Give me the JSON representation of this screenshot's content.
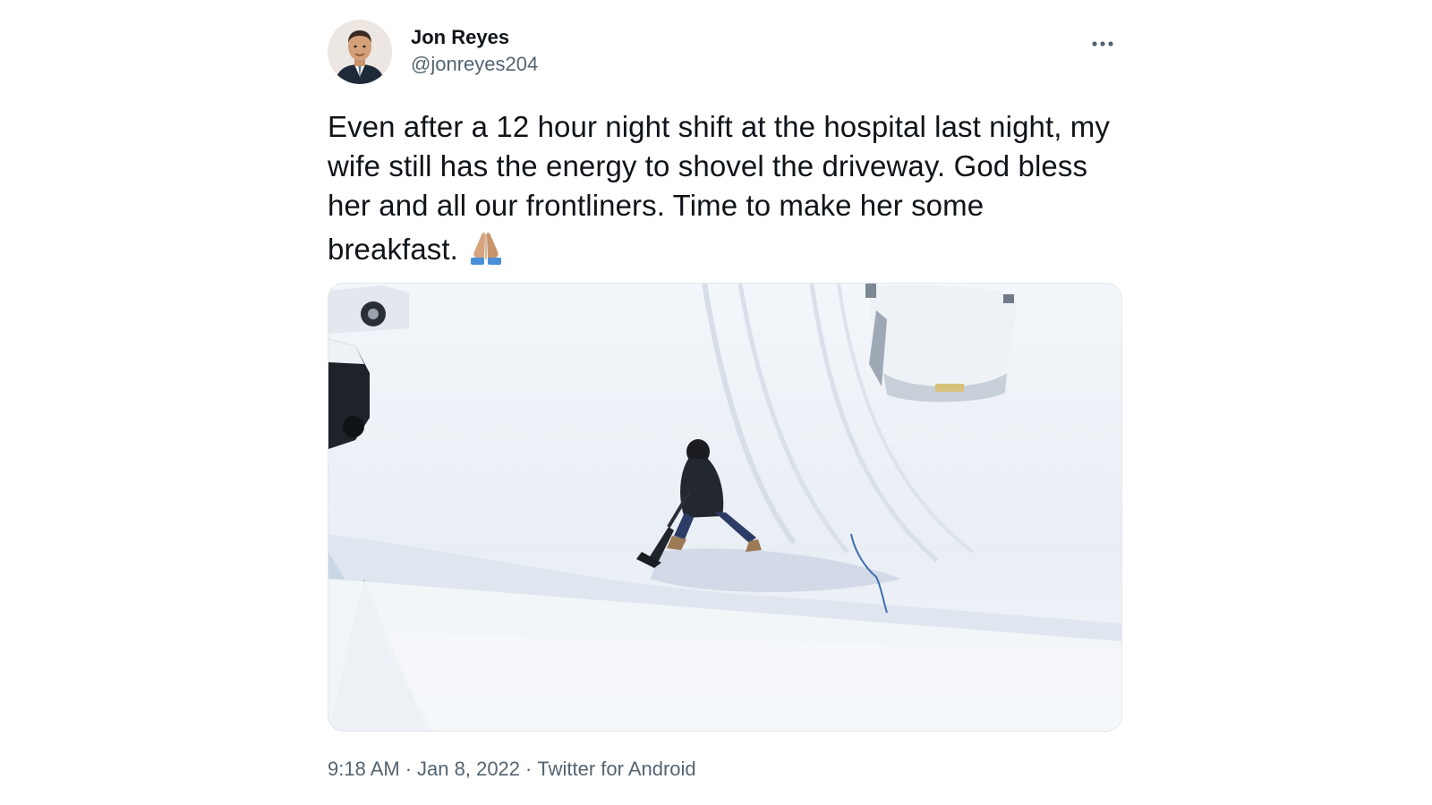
{
  "tweet": {
    "author": {
      "display_name": "Jon Reyes",
      "handle": "@jonreyes204"
    },
    "text": "Even after a 12 hour night shift at the hospital last night, my wife still has the energy to shovel the driveway. God bless her and all our frontliners. Time to make her some breakfast.",
    "emoji": "folded-hands-icon",
    "meta": {
      "time": "9:18 AM",
      "separator": "·",
      "date": "Jan 8, 2022",
      "source": "Twitter for Android"
    }
  },
  "colors": {
    "text_primary": "#0f1419",
    "text_secondary": "#536471",
    "media_border": "#e3e8ec"
  }
}
